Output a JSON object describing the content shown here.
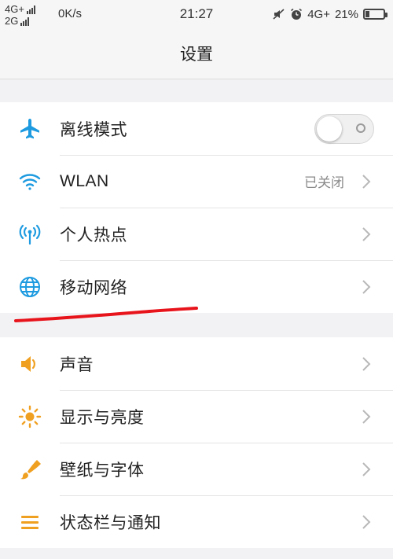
{
  "status_bar": {
    "net1": "4G+",
    "net2": "2G",
    "speed": "0K/s",
    "time": "21:27",
    "net_right": "4G+",
    "battery_pct": "21%",
    "battery_level": 0.21
  },
  "header": {
    "title": "设置"
  },
  "group1": {
    "items": [
      {
        "label": "离线模式",
        "icon": "airplane-icon",
        "control": "toggle",
        "toggle_on": false
      },
      {
        "label": "WLAN",
        "icon": "wifi-icon",
        "value": "已关闭"
      },
      {
        "label": "个人热点",
        "icon": "hotspot-icon"
      },
      {
        "label": "移动网络",
        "icon": "globe-icon"
      }
    ]
  },
  "group2": {
    "items": [
      {
        "label": "声音",
        "icon": "speaker-icon"
      },
      {
        "label": "显示与亮度",
        "icon": "brightness-icon"
      },
      {
        "label": "壁纸与字体",
        "icon": "brush-icon"
      },
      {
        "label": "状态栏与通知",
        "icon": "notification-list-icon"
      }
    ]
  },
  "colors": {
    "accent_blue": "#1e9be0",
    "accent_orange": "#f0a020",
    "annotation_red": "#e8141c"
  }
}
